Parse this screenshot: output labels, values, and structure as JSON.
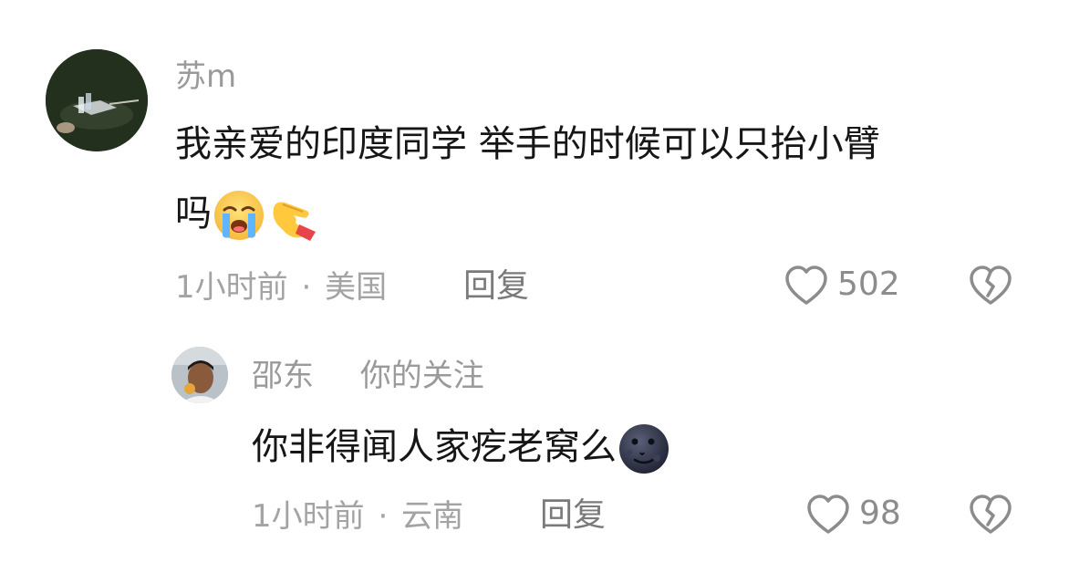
{
  "comments": [
    {
      "author": "苏m",
      "text_line1": "我亲爱的印度同学 举手的时候可以只抬小臂",
      "text_line2": "吗",
      "emojis": [
        "crying-face",
        "backhand-index-pointing-right"
      ],
      "time": "1小时前",
      "separator": "·",
      "location": "美国",
      "reply_label": "回复",
      "likes": "502",
      "icons": {
        "like": "heart-outline-icon",
        "dislike": "broken-heart-icon"
      }
    },
    {
      "author": "邵东",
      "author_tag": "你的关注",
      "text": "你非得闻人家疙老窝么",
      "emojis": [
        "new-moon-face"
      ],
      "time": "1小时前",
      "separator": "·",
      "location": "云南",
      "reply_label": "回复",
      "likes": "98",
      "icons": {
        "like": "heart-outline-icon",
        "dislike": "broken-heart-icon"
      }
    }
  ],
  "colors": {
    "text": "#161616",
    "meta": "#a3a3a3",
    "icon": "#8c8c8c",
    "background": "#ffffff"
  }
}
